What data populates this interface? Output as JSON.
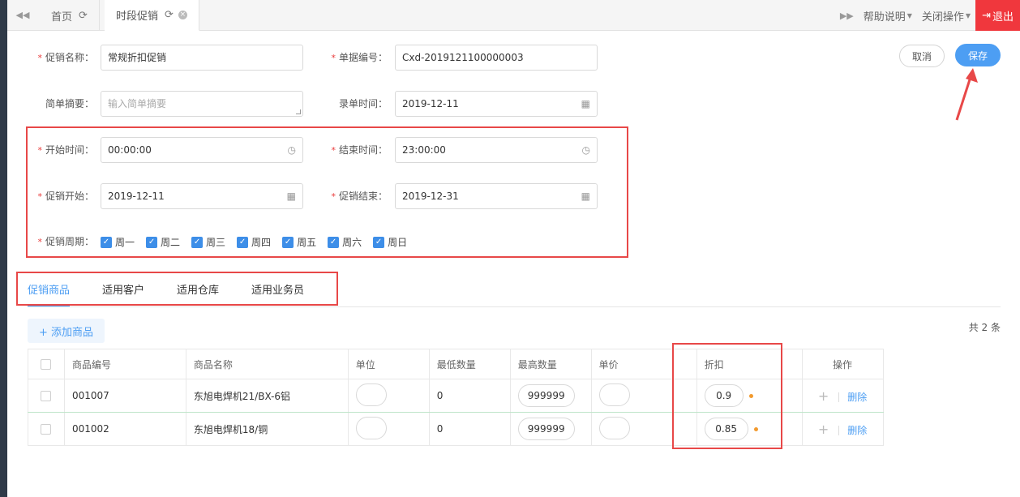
{
  "topbar": {
    "tabs": [
      {
        "label": "首页"
      },
      {
        "label": "时段促销"
      }
    ],
    "help_label": "帮助说明",
    "close_ops_label": "关闭操作",
    "logout_label": "退出"
  },
  "form": {
    "promo_name": {
      "label": "促销名称：",
      "value": "常规折扣促销"
    },
    "doc_no": {
      "label": "单据编号：",
      "value": "Cxd-2019121100000003"
    },
    "summary": {
      "label": "简单摘要：",
      "placeholder": "输入简单摘要"
    },
    "entry_time": {
      "label": "录单时间：",
      "value": "2019-12-11"
    },
    "start_time": {
      "label": "开始时间：",
      "value": "00:00:00"
    },
    "end_time": {
      "label": "结束时间：",
      "value": "23:00:00"
    },
    "promo_start": {
      "label": "促销开始：",
      "value": "2019-12-11"
    },
    "promo_end": {
      "label": "促销结束：",
      "value": "2019-12-31"
    },
    "cycle": {
      "label": "促销周期：",
      "days": [
        "周一",
        "周二",
        "周三",
        "周四",
        "周五",
        "周六",
        "周日"
      ]
    }
  },
  "actions": {
    "cancel": "取消",
    "save": "保存"
  },
  "subtabs": [
    "促销商品",
    "适用客户",
    "适用仓库",
    "适用业务员"
  ],
  "products": {
    "add_label": "+ 添加商品",
    "total": "共 2 条",
    "columns": [
      "商品编号",
      "商品名称",
      "单位",
      "最低数量",
      "最高数量",
      "单价",
      "折扣",
      "操作"
    ],
    "rows": [
      {
        "code": "001007",
        "name": "东旭电焊机21/BX-6铝",
        "unit": "",
        "min_qty": "0",
        "max_qty": "999999",
        "price": "",
        "discount": "0.9"
      },
      {
        "code": "001002",
        "name": "东旭电焊机18/铜",
        "unit": "",
        "min_qty": "0",
        "max_qty": "999999",
        "price": "",
        "discount": "0.85"
      }
    ],
    "delete_label": "删除"
  },
  "colors": {
    "accent": "#4d9ef3",
    "danger": "#f0373d",
    "annotation": "#e84848",
    "dot": "#f29a2e"
  }
}
